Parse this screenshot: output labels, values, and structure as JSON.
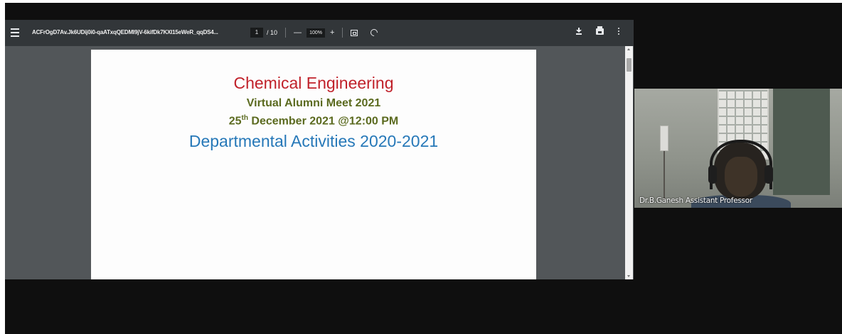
{
  "pdf_viewer": {
    "document_title": "ACFrOgD7Av.Jk6UDij0i0-qaATxqQEDMI9jV-6kifDk7KXI15eWeR_qqDS4...",
    "page_number": "1",
    "page_total": "/ 10",
    "zoom_out_label": "—",
    "zoom_level": "100%",
    "zoom_in_label": "+"
  },
  "slide": {
    "title": "Chemical Engineering",
    "subtitle": "Virtual Alumni Meet 2021",
    "date_day": "25",
    "date_suffix": "th",
    "date_rest": " December 2021 @12:00 PM",
    "heading": "Departmental Activities 2020-2021"
  },
  "participant": {
    "name": "Dr.B.Ganesh Assistant Professor"
  },
  "icons": {
    "menu": "hamburger-menu-icon",
    "fit": "fit-to-page-icon",
    "rotate": "rotate-icon",
    "download": "download-icon",
    "print": "print-icon",
    "more": "more-vert-icon"
  },
  "colors": {
    "title": "#c0212a",
    "subtitle": "#5b6a1f",
    "heading": "#2678b8",
    "toolbar": "#323639",
    "viewer_bg": "#525659"
  }
}
